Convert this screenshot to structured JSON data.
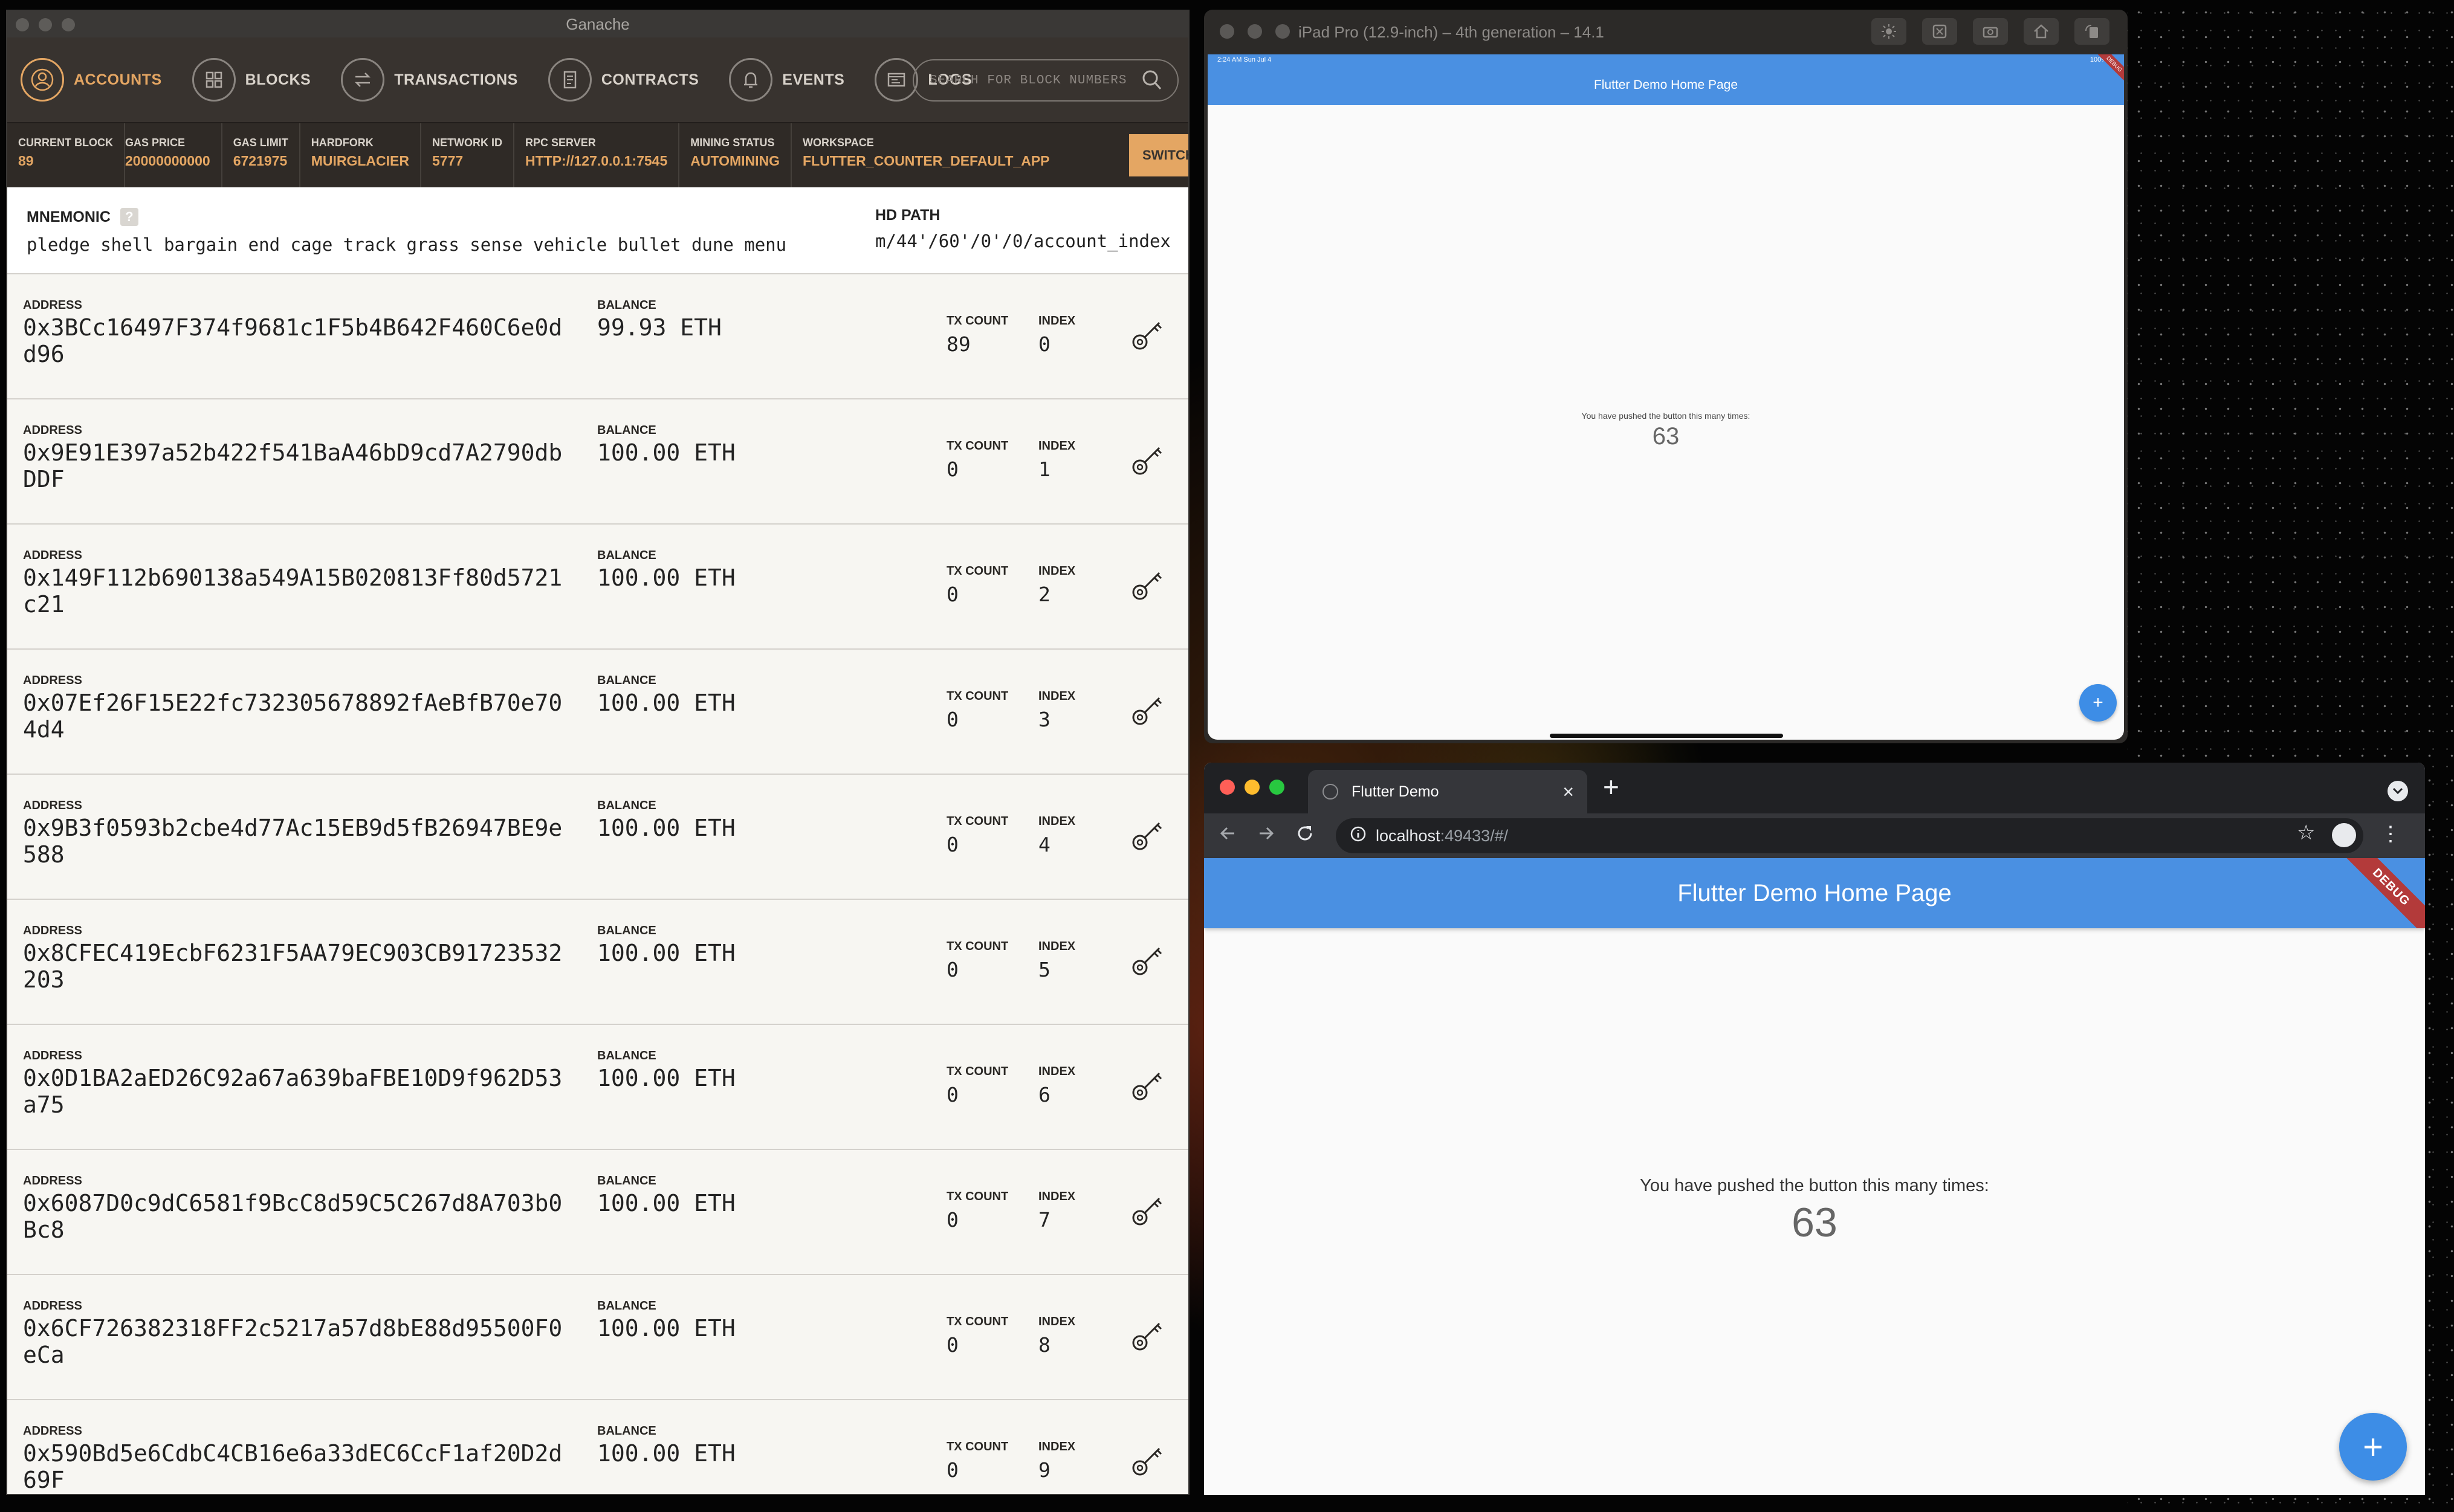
{
  "ganache": {
    "window_title": "Ganache",
    "nav": [
      {
        "label": "ACCOUNTS",
        "icon": "user-icon",
        "active": true
      },
      {
        "label": "BLOCKS",
        "icon": "blocks-icon",
        "active": false
      },
      {
        "label": "TRANSACTIONS",
        "icon": "transactions-icon",
        "active": false
      },
      {
        "label": "CONTRACTS",
        "icon": "contracts-icon",
        "active": false
      },
      {
        "label": "EVENTS",
        "icon": "bell-icon",
        "active": false
      },
      {
        "label": "LOGS",
        "icon": "logs-icon",
        "active": false
      }
    ],
    "search_placeholder": "SEARCH FOR BLOCK NUMBERS",
    "info": [
      {
        "key": "CURRENT BLOCK",
        "value": "89"
      },
      {
        "key": "GAS PRICE",
        "value": "20000000000"
      },
      {
        "key": "GAS LIMIT",
        "value": "6721975"
      },
      {
        "key": "HARDFORK",
        "value": "MUIRGLACIER"
      },
      {
        "key": "NETWORK ID",
        "value": "5777"
      },
      {
        "key": "RPC SERVER",
        "value": "HTTP://127.0.0.1:7545"
      },
      {
        "key": "MINING STATUS",
        "value": "AUTOMINING"
      },
      {
        "key": "WORKSPACE",
        "value": "FLUTTER_COUNTER_DEFAULT_APP"
      }
    ],
    "switch_label": "SWITCH",
    "mnemonic_label": "MNEMONIC",
    "mnemonic_help": "?",
    "mnemonic": "pledge shell bargain end cage track grass sense vehicle bullet dune menu",
    "hd_path_label": "HD PATH",
    "hd_path": "m/44'/60'/0'/0/account_index",
    "labels": {
      "address": "ADDRESS",
      "balance": "BALANCE",
      "tx_count": "TX COUNT",
      "index": "INDEX"
    },
    "accounts": [
      {
        "address": "0x3BCc16497F374f9681c1F5b4B642F460C6e0dd96",
        "balance": "99.93 ETH",
        "tx_count": "89",
        "index": "0"
      },
      {
        "address": "0x9E91E397a52b422f541BaA46bD9cd7A2790dbDDF",
        "balance": "100.00 ETH",
        "tx_count": "0",
        "index": "1"
      },
      {
        "address": "0x149F112b690138a549A15B020813Ff80d5721c21",
        "balance": "100.00 ETH",
        "tx_count": "0",
        "index": "2"
      },
      {
        "address": "0x07Ef26F15E22fc732305678892fAeBfB70e704d4",
        "balance": "100.00 ETH",
        "tx_count": "0",
        "index": "3"
      },
      {
        "address": "0x9B3f0593b2cbe4d77Ac15EB9d5fB26947BE9e588",
        "balance": "100.00 ETH",
        "tx_count": "0",
        "index": "4"
      },
      {
        "address": "0x8CFEC419EcbF6231F5AA79EC903CB91723532203",
        "balance": "100.00 ETH",
        "tx_count": "0",
        "index": "5"
      },
      {
        "address": "0x0D1BA2aED26C92a67a639baFBE10D9f962D53a75",
        "balance": "100.00 ETH",
        "tx_count": "0",
        "index": "6"
      },
      {
        "address": "0x6087D0c9dC6581f9BcC8d59C5C267d8A703b0Bc8",
        "balance": "100.00 ETH",
        "tx_count": "0",
        "index": "7"
      },
      {
        "address": "0x6CF726382318FF2c5217a57d8bE88d95500F0eCa",
        "balance": "100.00 ETH",
        "tx_count": "0",
        "index": "8"
      },
      {
        "address": "0x590Bd5e6CdbC4CB16e6a33dEC6CcF1af20D2d69F",
        "balance": "100.00 ETH",
        "tx_count": "0",
        "index": "9"
      }
    ]
  },
  "simulator": {
    "title": "iPad Pro (12.9-inch) – 4th generation – 14.1",
    "status_time": "2:24 AM   Sun Jul 4",
    "status_battery": "100%",
    "app_title": "Flutter Demo Home Page",
    "message": "You have pushed the button this many times:",
    "counter": "63",
    "fab_icon": "+",
    "debug_banner": "DEBUG"
  },
  "chrome": {
    "tab_title": "Flutter Demo",
    "url_host": "localhost",
    "url_path": ":49433/#/",
    "app_title": "Flutter Demo Home Page",
    "message": "You have pushed the button this many times:",
    "counter": "63",
    "fab_icon": "+",
    "debug_banner": "DEBUG",
    "traffic_lights": [
      "#ff5f57",
      "#febc2e",
      "#28c840"
    ]
  },
  "colors": {
    "ganache_accent": "#e4a663",
    "flutter_blue": "#4a90e2",
    "fab_blue": "#3d8de6"
  }
}
